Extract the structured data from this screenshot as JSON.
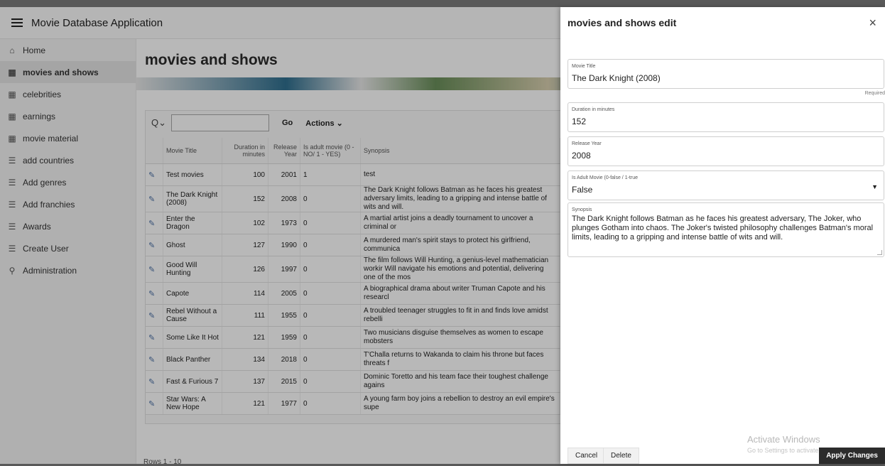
{
  "app": {
    "title": "Movie Database Application",
    "sidebar": [
      {
        "label": "Home",
        "icon": "home-icon",
        "glyph": "⌂",
        "active": false
      },
      {
        "label": "movies and shows",
        "icon": "table-icon",
        "glyph": "▦",
        "active": true
      },
      {
        "label": "celebrities",
        "icon": "table-icon",
        "glyph": "▦",
        "active": false
      },
      {
        "label": "earnings",
        "icon": "table-icon",
        "glyph": "▦",
        "active": false
      },
      {
        "label": "movie material",
        "icon": "table-icon",
        "glyph": "▦",
        "active": false
      },
      {
        "label": "add countries",
        "icon": "form-icon",
        "glyph": "☰",
        "active": false
      },
      {
        "label": "Add genres",
        "icon": "form-icon",
        "glyph": "☰",
        "active": false
      },
      {
        "label": "Add franchies",
        "icon": "form-icon",
        "glyph": "☰",
        "active": false
      },
      {
        "label": "Awards",
        "icon": "form-icon",
        "glyph": "☰",
        "active": false
      },
      {
        "label": "Create User",
        "icon": "form-icon",
        "glyph": "☰",
        "active": false
      },
      {
        "label": "Administration",
        "icon": "admin-icon",
        "glyph": "⚲",
        "active": false
      }
    ],
    "page_title": "movies and shows",
    "toolbar": {
      "go": "Go",
      "actions": "Actions ⌄"
    },
    "columns": [
      "Movie Title",
      "Duration in minutes",
      "Release Year",
      "Is adult movie (0 - NO/ 1 - YES)",
      "Synopsis"
    ],
    "rows": [
      {
        "title": "Test movies",
        "duration": "100",
        "year": "2001",
        "adult": "1",
        "synopsis": "test"
      },
      {
        "title": "The Dark Knight (2008)",
        "duration": "152",
        "year": "2008",
        "adult": "0",
        "synopsis": "The Dark Knight follows Batman as he faces his greatest adversary limits, leading to a gripping and intense battle of wits and will."
      },
      {
        "title": "Enter the Dragon",
        "duration": "102",
        "year": "1973",
        "adult": "0",
        "synopsis": "A martial artist joins a deadly tournament to uncover a criminal or"
      },
      {
        "title": "Ghost",
        "duration": "127",
        "year": "1990",
        "adult": "0",
        "synopsis": "A murdered man's spirit stays to protect his girlfriend, communica"
      },
      {
        "title": "Good Will Hunting",
        "duration": "126",
        "year": "1997",
        "adult": "0",
        "synopsis": "The film follows Will Hunting, a genius-level mathematician workir Will navigate his emotions and potential, delivering one of the mos"
      },
      {
        "title": "Capote",
        "duration": "114",
        "year": "2005",
        "adult": "0",
        "synopsis": "A biographical drama about writer Truman Capote and his researcl"
      },
      {
        "title": "Rebel Without a Cause",
        "duration": "111",
        "year": "1955",
        "adult": "0",
        "synopsis": "A troubled teenager struggles to fit in and finds love amidst rebelli"
      },
      {
        "title": "Some Like It Hot",
        "duration": "121",
        "year": "1959",
        "adult": "0",
        "synopsis": "Two musicians disguise themselves as women to escape mobsters"
      },
      {
        "title": "Black Panther",
        "duration": "134",
        "year": "2018",
        "adult": "0",
        "synopsis": "T'Challa returns to Wakanda to claim his throne but faces threats f"
      },
      {
        "title": "Fast & Furious 7",
        "duration": "137",
        "year": "2015",
        "adult": "0",
        "synopsis": "Dominic Toretto and his team face their toughest challenge agains"
      },
      {
        "title": "Star Wars: A New Hope",
        "duration": "121",
        "year": "1977",
        "adult": "0",
        "synopsis": "A young farm boy joins a rebellion to destroy an evil empire's supe"
      }
    ],
    "footer": "Rows 1 - 10"
  },
  "drawer": {
    "title": "movies and shows edit",
    "close_glyph": "×",
    "movie_title_label": "Movie Title",
    "movie_title_value": "The Dark Knight (2008)",
    "required": "Required",
    "duration_label": "Duration in minutes",
    "duration_value": "152",
    "release_label": "Release Year",
    "release_value": "2008",
    "adult_label": "Is Adult Movie (0-false / 1-true",
    "adult_value": "False",
    "synopsis_label": "Synopsis",
    "synopsis_value": "The Dark Knight follows Batman as he faces his greatest adversary, The Joker, who plunges Gotham into chaos. The Joker's twisted philosophy challenges Batman's moral limits, leading to a gripping and intense battle of wits and will.",
    "cancel": "Cancel",
    "delete": "Delete",
    "apply": "Apply Changes",
    "watermark_title": "Activate Windows",
    "watermark_sub": "Go to Settings to activate Windows."
  }
}
